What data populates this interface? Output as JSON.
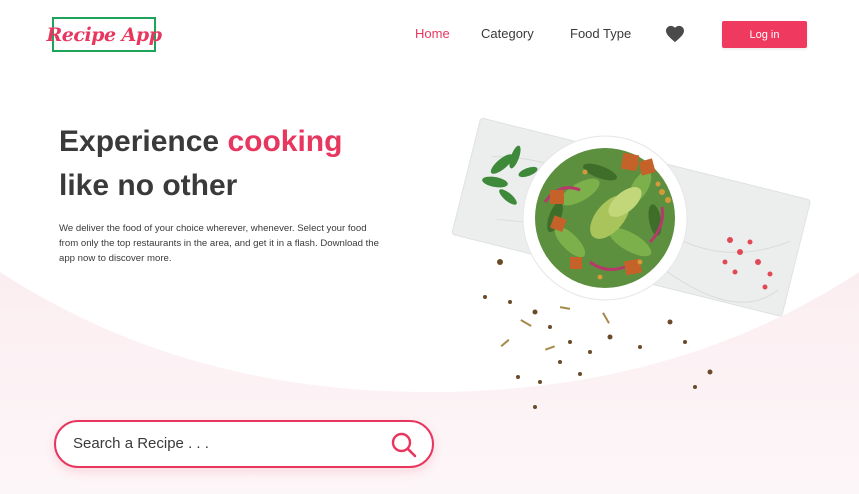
{
  "brand": {
    "logo_text": "Recipe App",
    "logo_border_color": "#1fa25a",
    "accent_color": "#e8375f"
  },
  "nav": {
    "items": [
      {
        "label": "Home",
        "active": true
      },
      {
        "label": "Category",
        "active": false
      },
      {
        "label": "Food Type",
        "active": false
      }
    ],
    "favorites_icon": "heart-icon",
    "login_label": "Log in"
  },
  "hero": {
    "title_part1": "Experience ",
    "title_accent": "cooking",
    "title_line2": "like no other",
    "description": "We deliver the food of your choice wherever, whenever. Select your food from only the top restaurants in the area, and get it in a flash. Download the app now to discover more."
  },
  "search": {
    "placeholder": "Search a Recipe . . .",
    "icon": "search-icon"
  }
}
